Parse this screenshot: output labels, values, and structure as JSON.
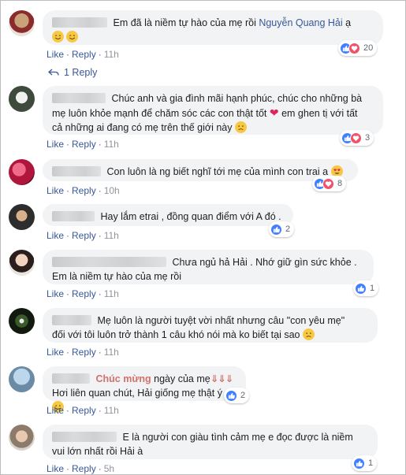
{
  "actions": {
    "like": "Like",
    "reply": "Reply",
    "sep": "·"
  },
  "comments": [
    {
      "text": "Em đã là niềm tự hào của mẹ rồi ",
      "mention": "Nguyễn Quang Hải",
      "suffix": " ạ",
      "time": "11h",
      "reaction_count": "20",
      "reactions": [
        "like-icon",
        "love-icon"
      ],
      "emojis": [
        "smile-emoji",
        "smile-emoji"
      ]
    },
    {
      "text1": "Chúc anh và gia đình mãi hạnh phúc, chúc cho những bà",
      "text2": "mẹ luôn khỏe mạnh để chăm sóc các con thật tốt",
      "text2b": " em ghen tị với tất",
      "text3": "cả những ai đang có mẹ trên thế giới này",
      "time": "11h",
      "reaction_count": "3",
      "reactions": [
        "like-icon",
        "love-icon"
      ]
    },
    {
      "text": "Con luôn là ng biết nghĩ tới mẹ của mình con trai ạ",
      "time": "10h",
      "reaction_count": "8",
      "reactions": [
        "like-icon",
        "love-icon"
      ]
    },
    {
      "text": "Hay lắm etrai , đồng quan điểm với A đó .",
      "time": "11h",
      "reaction_count": "2",
      "reactions": [
        "like-icon"
      ]
    },
    {
      "text1": "Chưa ngủ hả Hải . Nhớ giữ gìn sức khỏe .",
      "text2": "Em là niềm tự hào của mẹ rồi",
      "time": "11h",
      "reaction_count": "1",
      "reactions": [
        "like-icon"
      ]
    },
    {
      "text1": "Mẹ luôn là người tuyệt vời nhất nhưng câu \"con yêu mẹ\"",
      "text2": "đối với tôi luôn trở thành 1 câu khó nói mà ko biết tại sao",
      "time": "11h",
      "reactions": []
    },
    {
      "name": "Chúc mừng",
      "text1": " ngày của mẹ",
      "arrows": "⇓⇓⇓",
      "text2": "Hơi liên quan chút, Hải giống mẹ thật ý",
      "time": "11h",
      "reaction_count": "2",
      "reactions": [
        "like-icon"
      ]
    },
    {
      "text1": "E là người con giàu tình cảm mẹ e đọc được là niềm",
      "text2": "vui lớn nhất rồi Hải à",
      "time": "5h",
      "reaction_count": "1",
      "reactions": [
        "like-icon"
      ]
    }
  ],
  "reply_link": "1 Reply",
  "colors": {
    "link": "#385898",
    "bubble": "#f2f3f5",
    "like": "#4080ff",
    "love": "#f25268",
    "name": "#d2706b"
  }
}
